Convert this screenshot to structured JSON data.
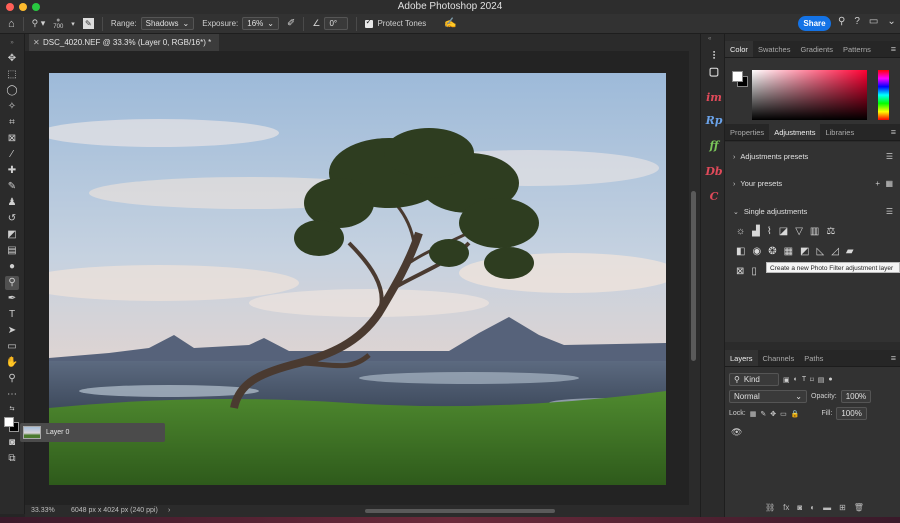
{
  "window": {
    "title": "Adobe Photoshop 2024"
  },
  "options_bar": {
    "brush_size": "700",
    "range_label": "Range:",
    "range_value": "Shadows",
    "exposure_label": "Exposure:",
    "exposure_value": "16%",
    "angle_value": "0°",
    "protect_tones_label": "Protect Tones",
    "share_label": "Share"
  },
  "document": {
    "tab_title": "DSC_4020.NEF @ 33.3% (Layer 0, RGB/16*) *",
    "zoom": "33.33%",
    "dimensions": "6048 px x 4024 px (240 ppi)"
  },
  "plugins": [
    "im",
    "Rp",
    "ff",
    "Db",
    "C"
  ],
  "color_panel": {
    "tabs": [
      "Color",
      "Swatches",
      "Gradients",
      "Patterns"
    ],
    "active_tab": "Color"
  },
  "adjustments_panel": {
    "tabs": [
      "Properties",
      "Adjustments",
      "Libraries"
    ],
    "active_tab": "Adjustments",
    "sections": [
      "Adjustments presets",
      "Your presets",
      "Single adjustments"
    ],
    "tooltip": "Create a new Photo Filter adjustment layer"
  },
  "layers_panel": {
    "tabs": [
      "Layers",
      "Channels",
      "Paths"
    ],
    "active_tab": "Layers",
    "filter_kind": "Kind",
    "blend_mode": "Normal",
    "opacity_label": "Opacity:",
    "opacity_value": "100%",
    "lock_label": "Lock:",
    "fill_label": "Fill:",
    "fill_value": "100%",
    "layers": [
      {
        "name": "Layer 0"
      }
    ]
  }
}
